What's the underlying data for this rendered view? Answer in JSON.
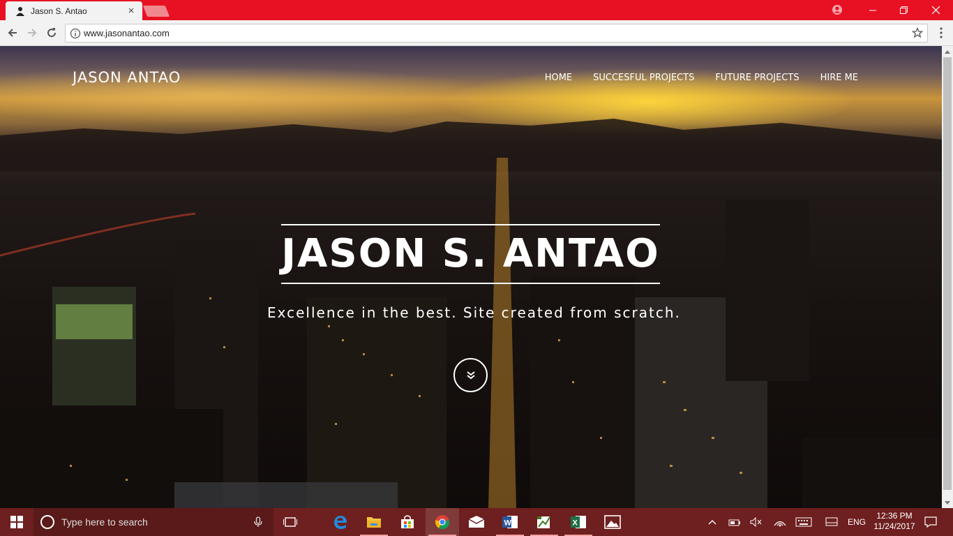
{
  "browser": {
    "tab_title": "Jason S. Antao",
    "tab_close": "×",
    "url": "www.jasonantao.com"
  },
  "page": {
    "brand": "JASON ANTAO",
    "nav": [
      "HOME",
      "SUCCESFUL PROJECTS",
      "FUTURE PROJECTS",
      "HIRE ME"
    ],
    "headline": "JASON S. ANTAO",
    "tagline": "Excellence in the best. Site created from scratch."
  },
  "taskbar": {
    "search_placeholder": "Type here to search",
    "language": "ENG",
    "time": "12:36 PM",
    "date": "11/24/2017",
    "pinned": [
      "task-view-icon",
      "edge-icon",
      "file-explorer-icon",
      "store-icon",
      "chrome-icon",
      "mail-icon",
      "word-icon",
      "project-icon",
      "excel-icon",
      "photos-icon"
    ]
  },
  "colors": {
    "titlebar": "#e81123",
    "taskbar": "#6e1f1f"
  }
}
